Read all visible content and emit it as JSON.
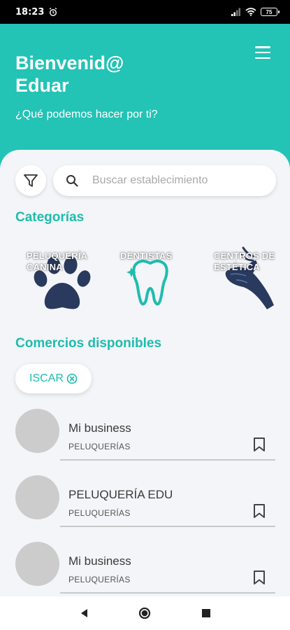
{
  "status_bar": {
    "time": "18:23",
    "battery": "75",
    "icons": [
      "alarm-icon",
      "signal-icon",
      "wifi-icon",
      "battery-icon"
    ]
  },
  "header": {
    "greeting_line1": "Bienvenid@",
    "greeting_line2": "Eduar",
    "subtitle": "¿Qué podemos hacer por ti?",
    "menu_icon": "hamburger-menu-icon",
    "background_color": "#23c3b5"
  },
  "search": {
    "placeholder": "Buscar establecimiento",
    "value": "",
    "filter_icon": "filter-icon",
    "search_icon": "search-icon"
  },
  "categories": {
    "title": "Categorías",
    "items": [
      {
        "label": "PELUQUERÍA CANINA",
        "icon": "paw-icon"
      },
      {
        "label": "DENTISTAS",
        "icon": "tooth-icon"
      },
      {
        "label": "CENTROS DE ESTÉTICA",
        "icon": "hand-icon"
      }
    ]
  },
  "businesses": {
    "title": "Comercios disponibles",
    "active_filter": "ISCAR",
    "items": [
      {
        "name": "Mi business",
        "category": "PELUQUERÍAS"
      },
      {
        "name": "PELUQUERÍA EDU",
        "category": "PELUQUERÍAS"
      },
      {
        "name": "Mi business",
        "category": "PELUQUERÍAS"
      }
    ]
  },
  "colors": {
    "accent": "#1fbcae",
    "dark_icon": "#2a3a5e",
    "avatar_placeholder": "#cccccc"
  },
  "nav_bar": {
    "icons": [
      "back-triangle-icon",
      "home-circle-icon",
      "recents-square-icon"
    ]
  }
}
